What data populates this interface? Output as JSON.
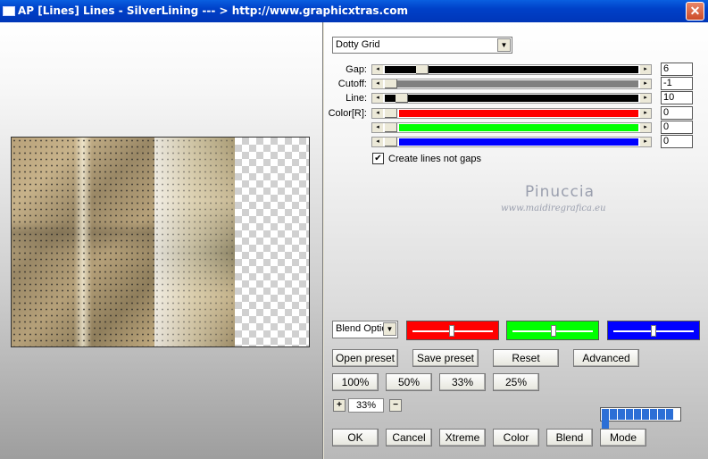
{
  "window": {
    "title": "AP [Lines]  Lines - SilverLining     --- > http://www.graphicxtras.com",
    "close_glyph": "✕"
  },
  "preset_select": {
    "value": "Dotty Grid"
  },
  "sliders": {
    "gap": {
      "label": "Gap:",
      "value": "6",
      "level": 0.06
    },
    "cutoff": {
      "label": "Cutoff:",
      "value": "-1",
      "level": 0.0
    },
    "line": {
      "label": "Line:",
      "value": "10",
      "level": 0.05
    },
    "color_r": {
      "label": "Color[R]:",
      "value": "0",
      "level": 0.0,
      "color": "#ff0000"
    },
    "color_g": {
      "label": "",
      "value": "0",
      "level": 0.0,
      "color": "#00ff00"
    },
    "color_b": {
      "label": "",
      "value": "0",
      "level": 0.0,
      "color": "#0000ff"
    }
  },
  "checkbox": {
    "label": "Create lines not gaps",
    "checked": true,
    "mark": "✔"
  },
  "watermark": {
    "name": "Pinuccia",
    "url": "www.maidiregrafica.eu"
  },
  "blend_select": {
    "value": "Blend Optio"
  },
  "color_bars": [
    {
      "name": "red",
      "color": "#ff0000",
      "level": 0.5
    },
    {
      "name": "green",
      "color": "#00ff00",
      "level": 0.5
    },
    {
      "name": "blue",
      "color": "#0000ff",
      "level": 0.5
    }
  ],
  "buttons": {
    "open_preset": "Open preset",
    "save_preset": "Save preset",
    "reset": "Reset",
    "advanced": "Advanced",
    "zoom_100": "100%",
    "zoom_50": "50%",
    "zoom_33": "33%",
    "zoom_25": "25%",
    "ok": "OK",
    "cancel": "Cancel",
    "xtreme": "Xtreme",
    "color": "Color",
    "blend": "Blend",
    "mode": "Mode"
  },
  "zoom": {
    "plus": "+",
    "minus": "−",
    "value": "33%"
  },
  "progress": {
    "blocks": 10
  }
}
